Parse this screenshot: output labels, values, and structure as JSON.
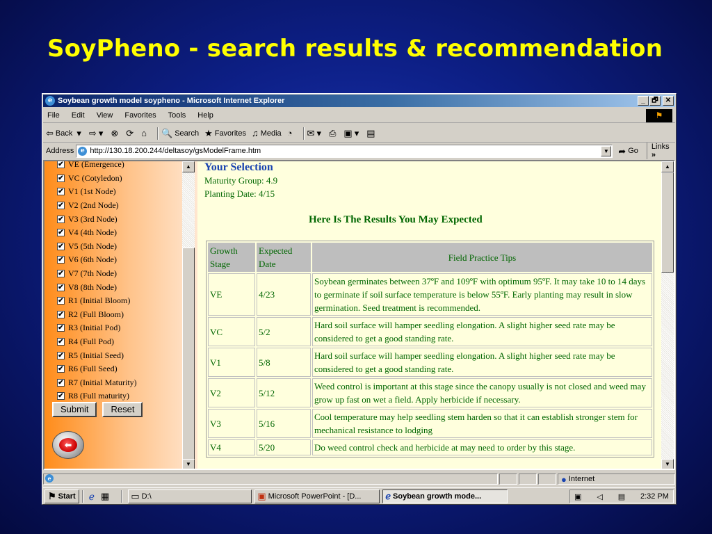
{
  "slide": {
    "title": "SoyPheno  - search results & recommendation"
  },
  "window": {
    "title": "Soybean growth model soypheno - Microsoft Internet Explorer",
    "controls": {
      "minimize": "_",
      "maximize": "🗗",
      "close": "✕"
    }
  },
  "menu": [
    "File",
    "Edit",
    "View",
    "Favorites",
    "Tools",
    "Help"
  ],
  "toolbar": {
    "back": "Back",
    "search": "Search",
    "favorites": "Favorites",
    "media": "Media"
  },
  "address": {
    "label": "Address",
    "url": "http://130.18.200.244/deltasoy/gsModelFrame.htm",
    "go": "Go",
    "links": "Links"
  },
  "stages": [
    "VE (Emergence)",
    "VC (Cotyledon)",
    "V1 (1st Node)",
    "V2 (2nd Node)",
    "V3 (3rd Node)",
    "V4 (4th Node)",
    "V5 (5th Node)",
    "V6 (6th Node)",
    "V7 (7th Node)",
    "V8 (8th Node)",
    "R1 (Initial Bloom)",
    "R2 (Full Bloom)",
    "R3 (Initial Pod)",
    "R4 (Full Pod)",
    "R5 (Initial Seed)",
    "R6 (Full Seed)",
    "R7 (Initial Maturity)",
    "R8 (Full maturity)"
  ],
  "form": {
    "submit": "Submit",
    "reset": "Reset"
  },
  "selection": {
    "title": "Your Selection",
    "maturity": "Maturity Group: 4.9",
    "planting": "Planting Date: 4/15"
  },
  "results": {
    "title": "Here Is The Results You May Expected",
    "headers": [
      "Growth Stage",
      "Expected Date",
      "Field Practice Tips"
    ],
    "rows": [
      {
        "stage": "VE",
        "date": "4/23",
        "tip": "Soybean germinates between 37ºF and 109ºF with optimum 95ºF. It may take 10 to 14 days to germinate if soil surface temperature is below 55ºF. Early planting may result in slow germination. Seed treatment is recommended."
      },
      {
        "stage": "VC",
        "date": "5/2",
        "tip": "Hard soil surface will hamper seedling elongation. A slight higher seed rate may be considered to get a good standing rate."
      },
      {
        "stage": "V1",
        "date": "5/8",
        "tip": "Hard soil surface will hamper seedling elongation. A slight higher seed rate may be considered to get a good standing rate."
      },
      {
        "stage": "V2",
        "date": "5/12",
        "tip": "Weed control is important at this stage since the canopy usually is not closed and weed may grow up fast on wet a field. Apply herbicide if necessary."
      },
      {
        "stage": "V3",
        "date": "5/16",
        "tip": "Cool temperature may help seedling stem harden so that it can establish stronger stem for mechanical resistance to lodging"
      },
      {
        "stage": "V4",
        "date": "5/20",
        "tip": "Do weed control check and herbicide at may need to order by this stage."
      }
    ]
  },
  "status": {
    "zone": "Internet"
  },
  "taskbar": {
    "start": "Start",
    "tasks": [
      "D:\\",
      "Microsoft PowerPoint - [D...",
      "Soybean growth mode..."
    ],
    "clock": "2:32 PM"
  }
}
